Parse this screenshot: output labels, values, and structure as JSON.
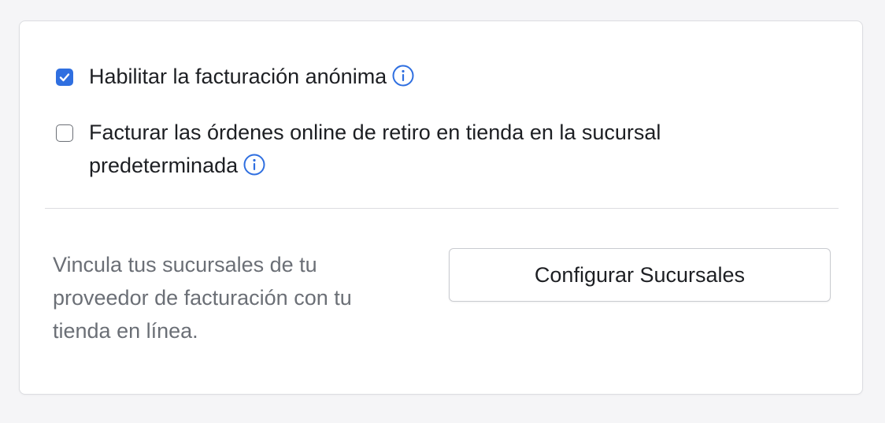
{
  "settings": {
    "anonymous_invoicing": {
      "label": "Habilitar la facturación anónima",
      "checked": true,
      "icon": "info-icon"
    },
    "pickup_orders_default_branch": {
      "label": "Facturar las órdenes online de retiro en tienda en la sucursal predeterminada",
      "checked": false,
      "icon": "info-icon"
    }
  },
  "branches": {
    "description": "Vincula tus sucursales de tu proveedor de facturación con tu tienda en línea.",
    "button_label": "Configurar Sucursales"
  },
  "colors": {
    "accent": "#2f6fe0",
    "text": "#1d1f23",
    "muted_text": "#6b6f76",
    "border": "#dcdde1",
    "background": "#f5f5f7"
  }
}
